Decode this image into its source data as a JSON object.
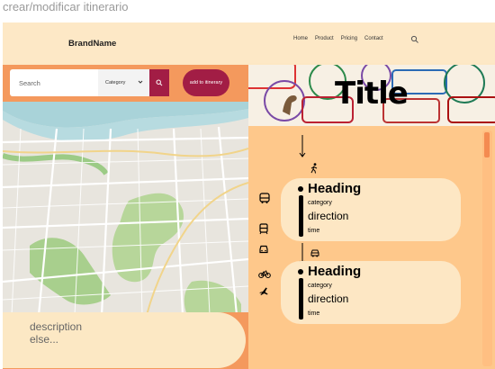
{
  "frame_title": "crear/modificar itinerario",
  "brand": "BrandName",
  "nav": {
    "links": [
      "Home",
      "Product",
      "Pricing",
      "Contact"
    ],
    "search_icon": "search-icon"
  },
  "search": {
    "placeholder": "Search",
    "category_label": "Category",
    "add_button": "add to itinerary"
  },
  "description": "description\nelse...",
  "banner": {
    "title": "Title"
  },
  "itinerary": {
    "cards": [
      {
        "heading": "Heading",
        "category": "category",
        "direction": "direction",
        "time": "time",
        "connector_icon": "walk-icon"
      },
      {
        "heading": "Heading",
        "category": "category",
        "direction": "direction",
        "time": "time",
        "connector_icon": "car-icon"
      }
    ],
    "transport_icons": [
      "bus-icon",
      "tram-icon",
      "car-front-icon",
      "bicycle-icon",
      "plane-icon"
    ]
  },
  "colors": {
    "accent": "#a21d45",
    "panel_orange": "#f4995d",
    "cream": "#fde7c4",
    "itinerary_bg": "#fec88b"
  }
}
